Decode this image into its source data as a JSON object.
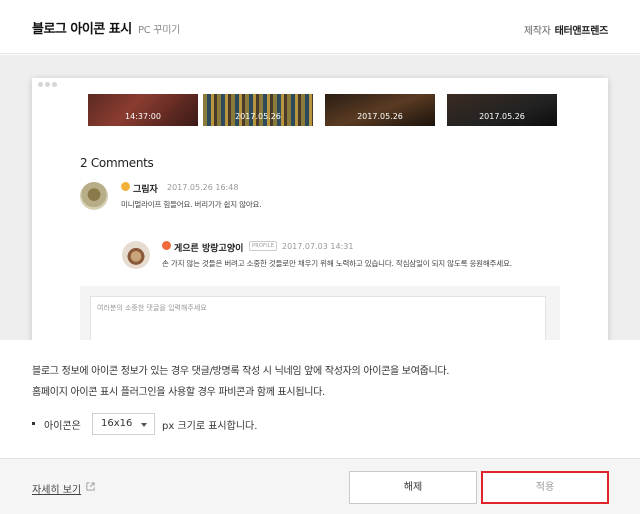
{
  "header": {
    "title": "블로그 아이콘 표시",
    "subtitle": "PC 꾸미기",
    "maker_label": "제작자",
    "maker_name": "태터앤프렌즈"
  },
  "preview": {
    "thumbnails": [
      {
        "date": "14:37:00"
      },
      {
        "date": "2017.05.26"
      },
      {
        "date": "2017.05.26"
      },
      {
        "date": "2017.05.26"
      }
    ],
    "comments_title": "2 Comments",
    "comments": [
      {
        "name": "그림자",
        "date": "2017.05.26 16:48",
        "text": "미니멀라이프 힘들어요. 버리기가 쉽지 않아요."
      },
      {
        "name": "게으른 방랑고양이",
        "profile_tag": "PROFILE",
        "date": "2017.07.03 14:31",
        "text": "손 가지 않는 것들은 버려고 소중한 것들로만 채우기 위해 노력하고 있습니다. 작심삼일이 되지 않도록 응원해주세요."
      }
    ],
    "reply_placeholder": "여러분의 소중한 댓글을 입력해주세요"
  },
  "description": {
    "line1": "블로그 정보에 아이콘 정보가 있는 경우 댓글/방명록 작성 시 닉네임 앞에 작성자의 아이콘을 보여줍니다.",
    "line2": "홈페이지 아이콘 표시 플러그인을 사용할 경우 파비콘과 함께 표시됩니다."
  },
  "option": {
    "label": "아이콘은",
    "selected": "16x16",
    "suffix": "px 크기로 표시합니다."
  },
  "footer": {
    "more_link": "자세히 보기",
    "cancel_label": "해제",
    "apply_label": "적용"
  },
  "colors": {
    "apply_highlight": "#e0242c",
    "preview_bg": "#eeeeee",
    "footer_bg": "#f5f5f5"
  }
}
